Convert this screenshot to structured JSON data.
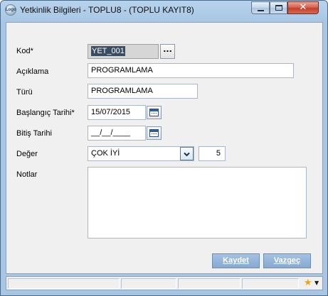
{
  "window": {
    "title": "Yetkinlik Bilgileri - TOPLU8 - (TOPLU KAYIT8)",
    "app_icon_text": "Logo"
  },
  "form": {
    "kod": {
      "label": "Kod*",
      "value": "YET_001",
      "lookup_label": "..."
    },
    "aciklama": {
      "label": "Açıklama",
      "value": "PROGRAMLAMA"
    },
    "turu": {
      "label": "Türü",
      "value": "PROGRAMLAMA"
    },
    "baslangic": {
      "label": "Başlangıç Tarihi*",
      "value": "15/07/2015"
    },
    "bitis": {
      "label": "Bitiş Tarihi",
      "value": "__/__/____"
    },
    "deger": {
      "label": "Değer",
      "selected": "ÇOK İYİ",
      "number": "5"
    },
    "notlar": {
      "label": "Notlar",
      "value": ""
    }
  },
  "buttons": {
    "save": "Kaydet",
    "cancel": "Vazgeç"
  },
  "colors": {
    "title_bar": "#b8d3ec",
    "close_button": "#c2402b",
    "action_button": "#87a9d1",
    "selection": "#3a4c63",
    "star": "#e8a317"
  },
  "icons": [
    "minimize-icon",
    "maximize-icon",
    "close-icon",
    "calendar-icon",
    "chevron-down-icon",
    "star-icon"
  ]
}
